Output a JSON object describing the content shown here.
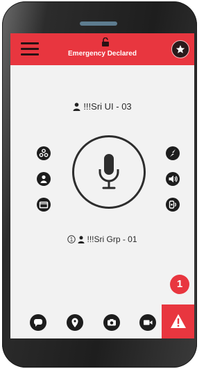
{
  "header": {
    "title": "Emergency Declared"
  },
  "call": {
    "caller_name": "!!!Sri UI - 03",
    "group_name": "!!!Sri Grp - 01",
    "group_count": "1"
  },
  "notifications": {
    "count": "1"
  },
  "colors": {
    "accent_red": "#e8363f",
    "dark": "#1d1d1d",
    "screen_bg": "#f2f2f2"
  },
  "icons": {
    "left_column": [
      "group-icon",
      "user-icon",
      "folder-icon"
    ],
    "right_column": [
      "connection-icon",
      "volume-icon",
      "audio-device-icon"
    ],
    "bottom_bar": [
      "chat-icon",
      "location-icon",
      "camera-icon",
      "video-icon",
      "emergency-alert-icon"
    ]
  }
}
